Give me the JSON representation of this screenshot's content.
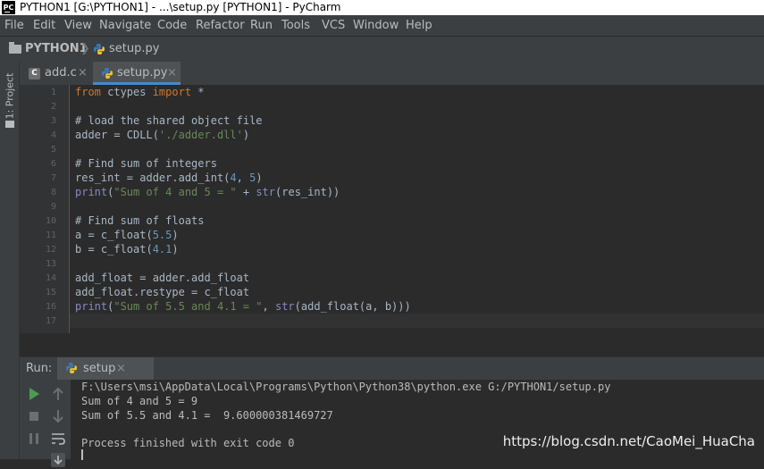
{
  "window": {
    "app_icon_text": "PC",
    "title": "PYTHON1 [G:\\PYTHON1] - ...\\setup.py [PYTHON1] - PyCharm"
  },
  "menu": [
    "File",
    "Edit",
    "View",
    "Navigate",
    "Code",
    "Refactor",
    "Run",
    "Tools",
    "VCS",
    "Window",
    "Help"
  ],
  "breadcrumb": {
    "project": "PYTHON1",
    "file": "setup.py"
  },
  "left_tool_tab": "1: Project",
  "editor_tabs": [
    {
      "label": "add.c",
      "icon": "c-file-icon",
      "active": false
    },
    {
      "label": "setup.py",
      "icon": "python-file-icon",
      "active": true
    }
  ],
  "code_lines": [
    {
      "n": "1"
    },
    {
      "n": "2"
    },
    {
      "n": "3"
    },
    {
      "n": "4"
    },
    {
      "n": "5"
    },
    {
      "n": "6"
    },
    {
      "n": "7"
    },
    {
      "n": "8"
    },
    {
      "n": "9"
    },
    {
      "n": "10"
    },
    {
      "n": "11"
    },
    {
      "n": "12"
    },
    {
      "n": "13"
    },
    {
      "n": "14"
    },
    {
      "n": "15"
    },
    {
      "n": "16"
    },
    {
      "n": "17"
    }
  ],
  "code": {
    "l1_from": "from",
    "l1_mid": " ctypes ",
    "l1_import": "import",
    "l1_star": " *",
    "l3": "# load the shared object file",
    "l4_a": "adder = CDLL(",
    "l4_s": "'./adder.dll'",
    "l4_b": ")",
    "l6": "# Find sum of integers",
    "l7_a": "res_int = adder.add_int(",
    "l7_n1": "4",
    "l7_c": ", ",
    "l7_n2": "5",
    "l7_b": ")",
    "l8_p": "print",
    "l8_a": "(",
    "l8_s": "\"Sum of 4 and 5 = \"",
    "l8_b": " + ",
    "l8_f": "str",
    "l8_c": "(res_int))",
    "l10": "# Find sum of floats",
    "l11_a": "a = c_float(",
    "l11_n": "5.5",
    "l11_b": ")",
    "l12_a": "b = c_float(",
    "l12_n": "4.1",
    "l12_b": ")",
    "l14": "add_float = adder.add_float",
    "l15": "add_float.restype = c_float",
    "l16_p": "print",
    "l16_a": "(",
    "l16_s": "\"Sum of 5.5 and 4.1 = \"",
    "l16_b": ", ",
    "l16_f": "str",
    "l16_c": "(add_float(a, b)))"
  },
  "run_panel": {
    "label": "Run:",
    "tab": "setup",
    "console": [
      "F:\\Users\\msi\\AppData\\Local\\Programs\\Python\\Python38\\python.exe G:/PYTHON1/setup.py",
      "Sum of 4 and 5 = 9",
      "Sum of 5.5 and 4.1 =  9.600000381469727",
      "",
      "Process finished with exit code 0"
    ]
  },
  "watermark": "https://blog.csdn.net/CaoMei_HuaCha",
  "colors": {
    "editor_bg": "#2b2b2b",
    "keyword": "#cc7832",
    "comment": "#808080",
    "string": "#6a8759",
    "number": "#6897bb",
    "builtin": "#8888c6",
    "run_green": "#499c54"
  }
}
